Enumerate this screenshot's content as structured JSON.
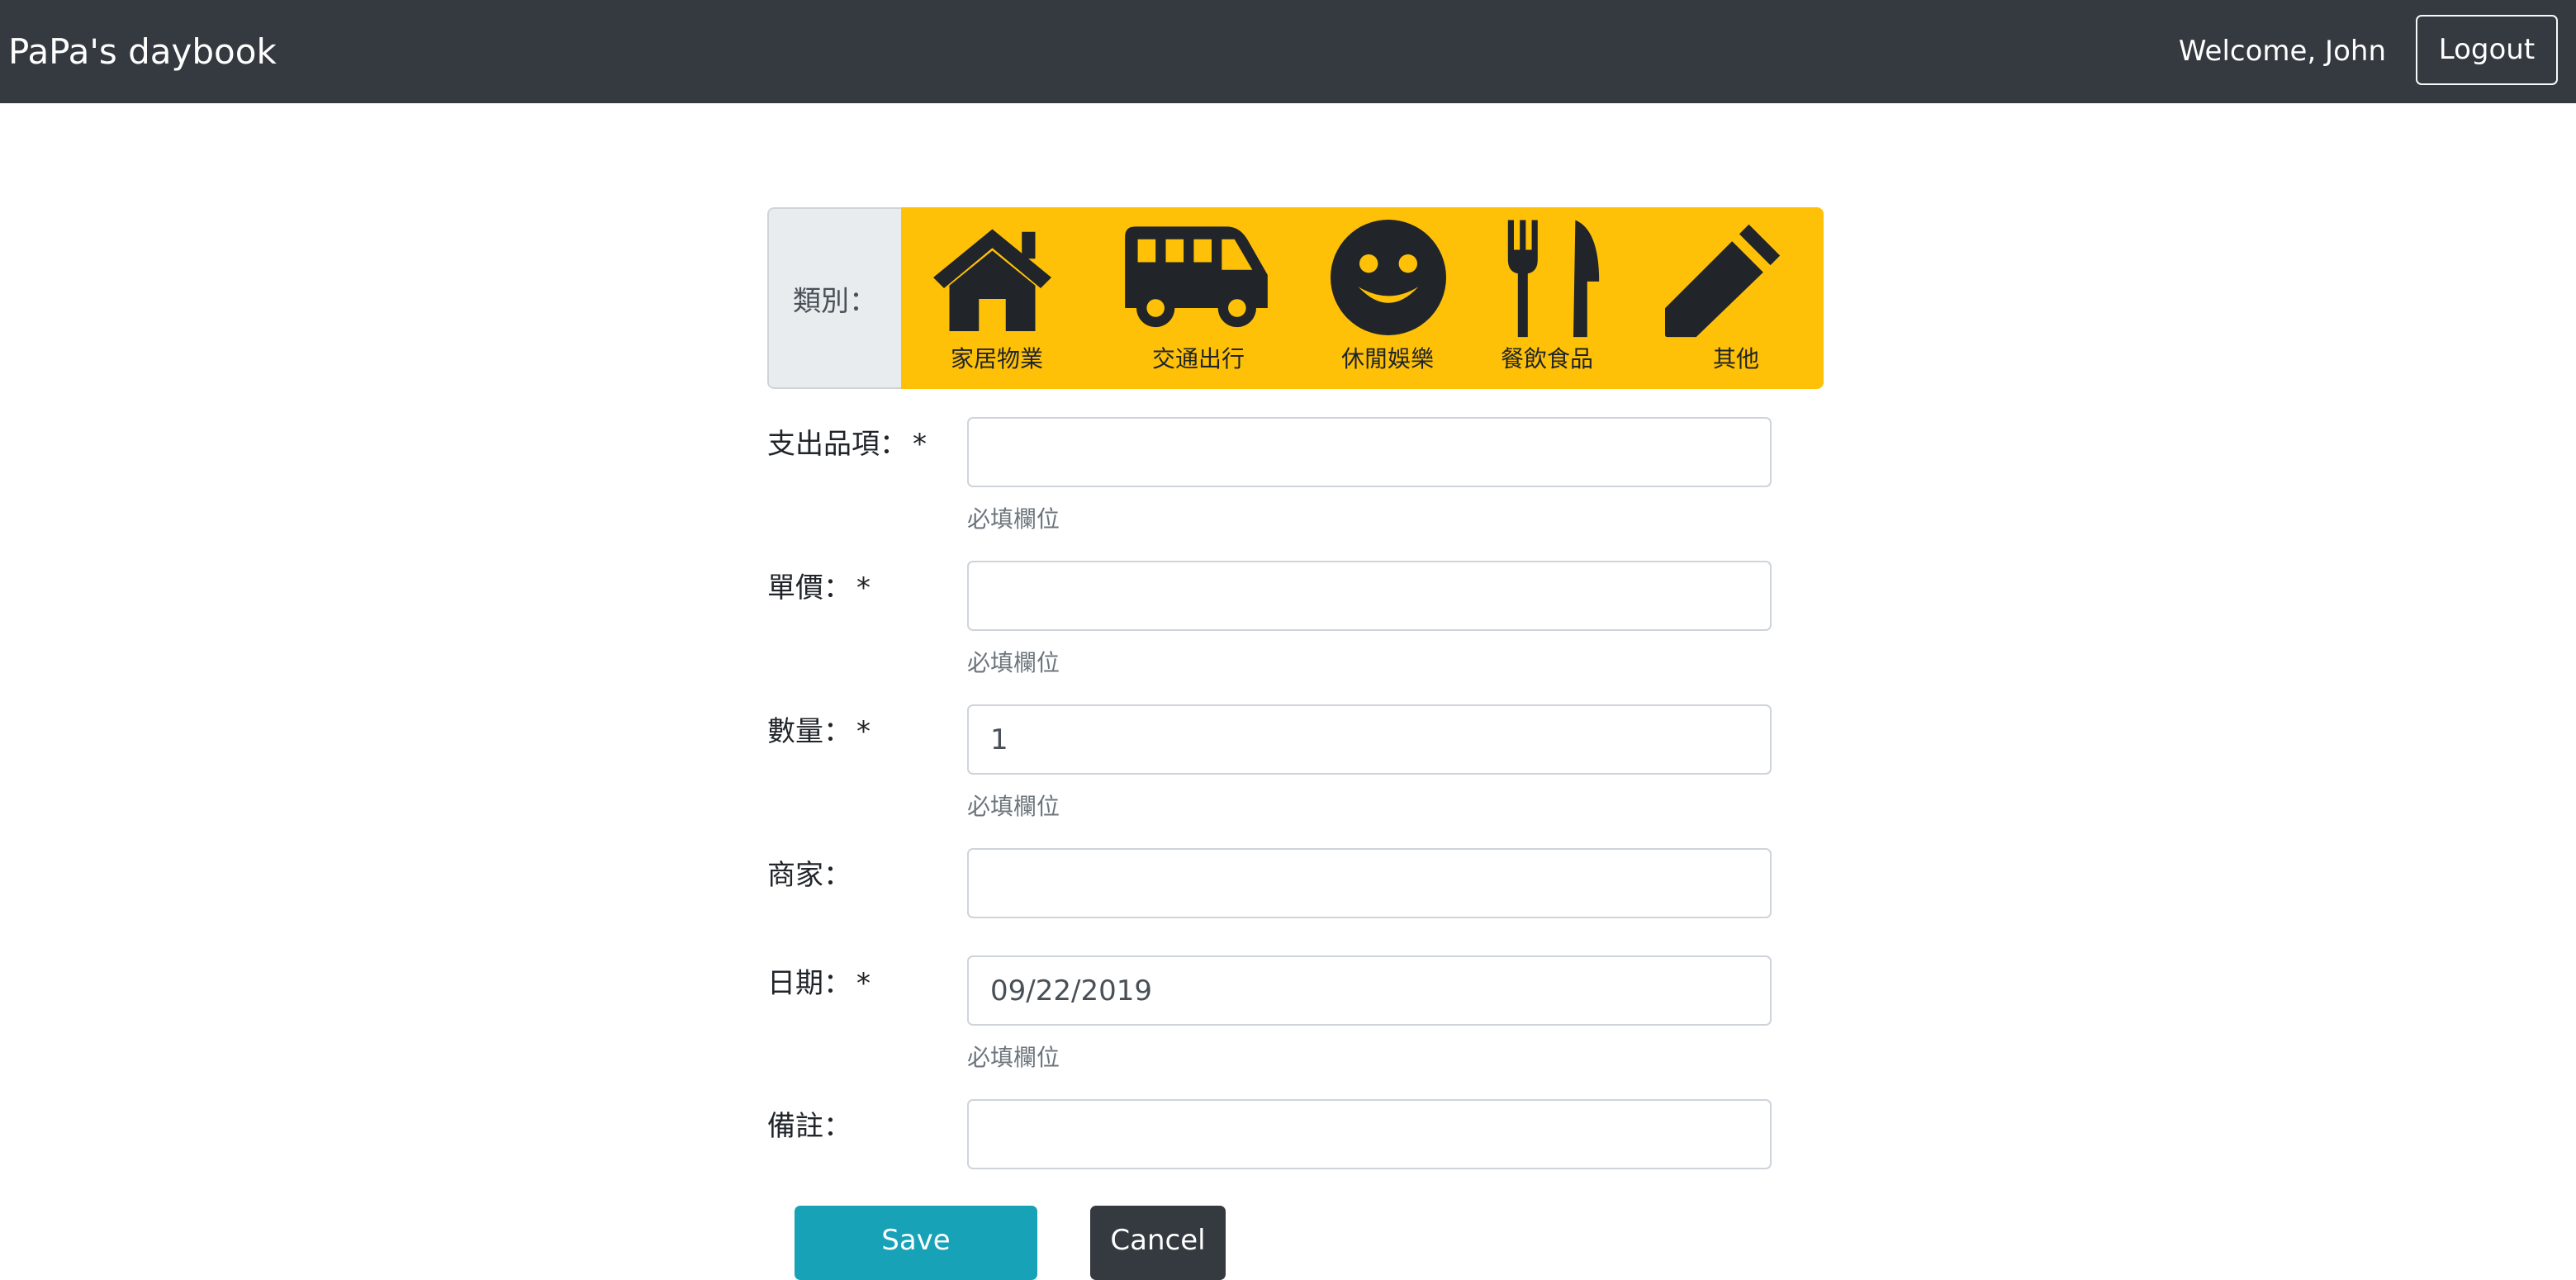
{
  "navbar": {
    "brand": "PaPa's daybook",
    "welcome": "Welcome, John",
    "logout_label": "Logout"
  },
  "category": {
    "label": "類別：",
    "accent_color": "#ffc107",
    "items": [
      {
        "icon": "house-icon",
        "label": "家居物業"
      },
      {
        "icon": "bus-icon",
        "label": "交通出行"
      },
      {
        "icon": "smile-icon",
        "label": "休閒娛樂"
      },
      {
        "icon": "utensils-icon",
        "label": "餐飲食品"
      },
      {
        "icon": "pencil-icon",
        "label": "其他"
      }
    ]
  },
  "form": {
    "item": {
      "label": "支出品項：",
      "required_mark": "*",
      "value": "",
      "help": "必填欄位"
    },
    "price": {
      "label": "單價：",
      "required_mark": "*",
      "value": "",
      "help": "必填欄位"
    },
    "quantity": {
      "label": "數量：",
      "required_mark": "*",
      "value": "1",
      "help": "必填欄位"
    },
    "merchant": {
      "label": "商家：",
      "value": ""
    },
    "date": {
      "label": "日期：",
      "required_mark": "*",
      "value": "09/22/2019",
      "help": "必填欄位"
    },
    "note": {
      "label": "備註：",
      "value": ""
    }
  },
  "actions": {
    "save_label": "Save",
    "cancel_label": "Cancel"
  }
}
